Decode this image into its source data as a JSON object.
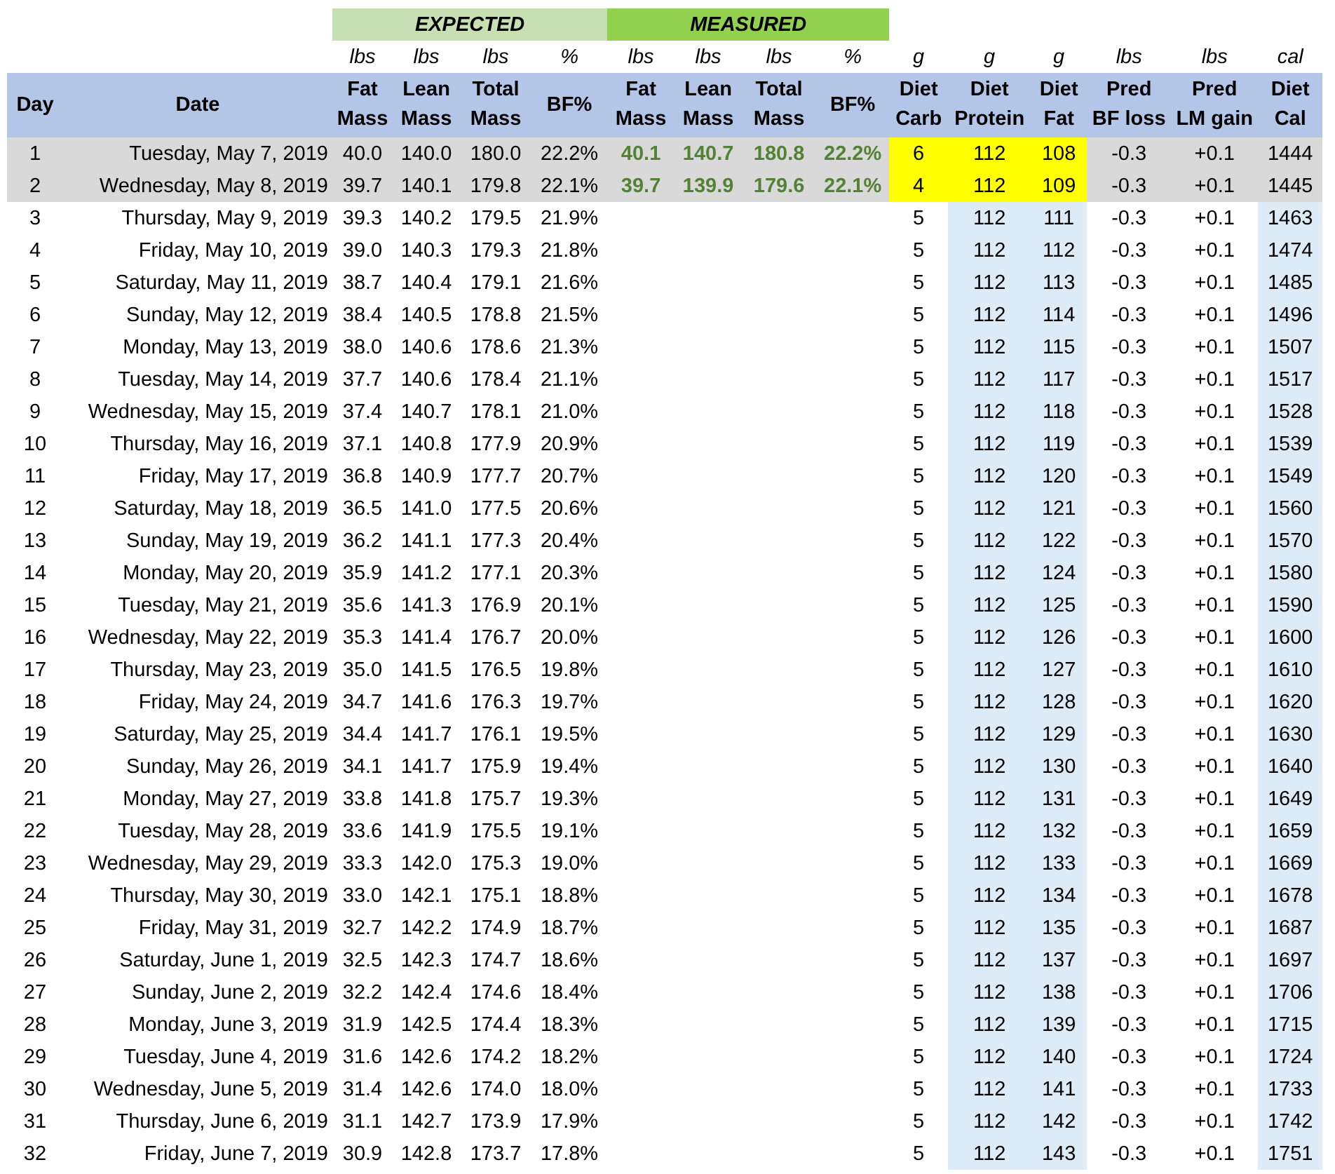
{
  "groups": [
    {
      "label": "EXPECTED",
      "color": "#c6e0b4"
    },
    {
      "label": "MEASURED",
      "color": "#92d050"
    }
  ],
  "units": [
    "lbs",
    "lbs",
    "lbs",
    "%",
    "lbs",
    "lbs",
    "lbs",
    "%",
    "g",
    "g",
    "g",
    "lbs",
    "lbs",
    "cal"
  ],
  "columns": [
    {
      "lines": [
        "Day"
      ]
    },
    {
      "lines": [
        "Date"
      ]
    },
    {
      "lines": [
        "Fat",
        "Mass"
      ]
    },
    {
      "lines": [
        "Lean",
        "Mass"
      ]
    },
    {
      "lines": [
        "Total",
        "Mass"
      ]
    },
    {
      "lines": [
        "BF%"
      ]
    },
    {
      "lines": [
        "Fat",
        "Mass"
      ]
    },
    {
      "lines": [
        "Lean",
        "Mass"
      ]
    },
    {
      "lines": [
        "Total",
        "Mass"
      ]
    },
    {
      "lines": [
        "BF%"
      ]
    },
    {
      "lines": [
        "Diet",
        "Carb"
      ]
    },
    {
      "lines": [
        "Diet",
        "Protein"
      ]
    },
    {
      "lines": [
        "Diet",
        "Fat"
      ]
    },
    {
      "lines": [
        "Pred",
        "BF loss"
      ]
    },
    {
      "lines": [
        "Pred",
        "LM gain"
      ]
    },
    {
      "lines": [
        "Diet",
        "Cal"
      ]
    }
  ],
  "rows": [
    {
      "day": "1",
      "date": "Tuesday, May 7, 2019",
      "expected": [
        "40.0",
        "140.0",
        "180.0",
        "22.2%"
      ],
      "measured": [
        "40.1",
        "140.7",
        "180.8",
        "22.2%"
      ],
      "diet": [
        "6",
        "112",
        "108"
      ],
      "pred": [
        "-0.3",
        "+0.1"
      ],
      "cal": "1444",
      "logged": true
    },
    {
      "day": "2",
      "date": "Wednesday, May 8, 2019",
      "expected": [
        "39.7",
        "140.1",
        "179.8",
        "22.1%"
      ],
      "measured": [
        "39.7",
        "139.9",
        "179.6",
        "22.1%"
      ],
      "diet": [
        "4",
        "112",
        "109"
      ],
      "pred": [
        "-0.3",
        "+0.1"
      ],
      "cal": "1445",
      "logged": true
    },
    {
      "day": "3",
      "date": "Thursday, May 9, 2019",
      "expected": [
        "39.3",
        "140.2",
        "179.5",
        "21.9%"
      ],
      "diet": [
        "5",
        "112",
        "111"
      ],
      "pred": [
        "-0.3",
        "+0.1"
      ],
      "cal": "1463",
      "logged": false
    },
    {
      "day": "4",
      "date": "Friday, May 10, 2019",
      "expected": [
        "39.0",
        "140.3",
        "179.3",
        "21.8%"
      ],
      "diet": [
        "5",
        "112",
        "112"
      ],
      "pred": [
        "-0.3",
        "+0.1"
      ],
      "cal": "1474",
      "logged": false
    },
    {
      "day": "5",
      "date": "Saturday, May 11, 2019",
      "expected": [
        "38.7",
        "140.4",
        "179.1",
        "21.6%"
      ],
      "diet": [
        "5",
        "112",
        "113"
      ],
      "pred": [
        "-0.3",
        "+0.1"
      ],
      "cal": "1485",
      "logged": false
    },
    {
      "day": "6",
      "date": "Sunday, May 12, 2019",
      "expected": [
        "38.4",
        "140.5",
        "178.8",
        "21.5%"
      ],
      "diet": [
        "5",
        "112",
        "114"
      ],
      "pred": [
        "-0.3",
        "+0.1"
      ],
      "cal": "1496",
      "logged": false
    },
    {
      "day": "7",
      "date": "Monday, May 13, 2019",
      "expected": [
        "38.0",
        "140.6",
        "178.6",
        "21.3%"
      ],
      "diet": [
        "5",
        "112",
        "115"
      ],
      "pred": [
        "-0.3",
        "+0.1"
      ],
      "cal": "1507",
      "logged": false
    },
    {
      "day": "8",
      "date": "Tuesday, May 14, 2019",
      "expected": [
        "37.7",
        "140.6",
        "178.4",
        "21.1%"
      ],
      "diet": [
        "5",
        "112",
        "117"
      ],
      "pred": [
        "-0.3",
        "+0.1"
      ],
      "cal": "1517",
      "logged": false
    },
    {
      "day": "9",
      "date": "Wednesday, May 15, 2019",
      "expected": [
        "37.4",
        "140.7",
        "178.1",
        "21.0%"
      ],
      "diet": [
        "5",
        "112",
        "118"
      ],
      "pred": [
        "-0.3",
        "+0.1"
      ],
      "cal": "1528",
      "logged": false
    },
    {
      "day": "10",
      "date": "Thursday, May 16, 2019",
      "expected": [
        "37.1",
        "140.8",
        "177.9",
        "20.9%"
      ],
      "diet": [
        "5",
        "112",
        "119"
      ],
      "pred": [
        "-0.3",
        "+0.1"
      ],
      "cal": "1539",
      "logged": false
    },
    {
      "day": "11",
      "date": "Friday, May 17, 2019",
      "expected": [
        "36.8",
        "140.9",
        "177.7",
        "20.7%"
      ],
      "diet": [
        "5",
        "112",
        "120"
      ],
      "pred": [
        "-0.3",
        "+0.1"
      ],
      "cal": "1549",
      "logged": false
    },
    {
      "day": "12",
      "date": "Saturday, May 18, 2019",
      "expected": [
        "36.5",
        "141.0",
        "177.5",
        "20.6%"
      ],
      "diet": [
        "5",
        "112",
        "121"
      ],
      "pred": [
        "-0.3",
        "+0.1"
      ],
      "cal": "1560",
      "logged": false
    },
    {
      "day": "13",
      "date": "Sunday, May 19, 2019",
      "expected": [
        "36.2",
        "141.1",
        "177.3",
        "20.4%"
      ],
      "diet": [
        "5",
        "112",
        "122"
      ],
      "pred": [
        "-0.3",
        "+0.1"
      ],
      "cal": "1570",
      "logged": false
    },
    {
      "day": "14",
      "date": "Monday, May 20, 2019",
      "expected": [
        "35.9",
        "141.2",
        "177.1",
        "20.3%"
      ],
      "diet": [
        "5",
        "112",
        "124"
      ],
      "pred": [
        "-0.3",
        "+0.1"
      ],
      "cal": "1580",
      "logged": false
    },
    {
      "day": "15",
      "date": "Tuesday, May 21, 2019",
      "expected": [
        "35.6",
        "141.3",
        "176.9",
        "20.1%"
      ],
      "diet": [
        "5",
        "112",
        "125"
      ],
      "pred": [
        "-0.3",
        "+0.1"
      ],
      "cal": "1590",
      "logged": false
    },
    {
      "day": "16",
      "date": "Wednesday, May 22, 2019",
      "expected": [
        "35.3",
        "141.4",
        "176.7",
        "20.0%"
      ],
      "diet": [
        "5",
        "112",
        "126"
      ],
      "pred": [
        "-0.3",
        "+0.1"
      ],
      "cal": "1600",
      "logged": false
    },
    {
      "day": "17",
      "date": "Thursday, May 23, 2019",
      "expected": [
        "35.0",
        "141.5",
        "176.5",
        "19.8%"
      ],
      "diet": [
        "5",
        "112",
        "127"
      ],
      "pred": [
        "-0.3",
        "+0.1"
      ],
      "cal": "1610",
      "logged": false
    },
    {
      "day": "18",
      "date": "Friday, May 24, 2019",
      "expected": [
        "34.7",
        "141.6",
        "176.3",
        "19.7%"
      ],
      "diet": [
        "5",
        "112",
        "128"
      ],
      "pred": [
        "-0.3",
        "+0.1"
      ],
      "cal": "1620",
      "logged": false
    },
    {
      "day": "19",
      "date": "Saturday, May 25, 2019",
      "expected": [
        "34.4",
        "141.7",
        "176.1",
        "19.5%"
      ],
      "diet": [
        "5",
        "112",
        "129"
      ],
      "pred": [
        "-0.3",
        "+0.1"
      ],
      "cal": "1630",
      "logged": false
    },
    {
      "day": "20",
      "date": "Sunday, May 26, 2019",
      "expected": [
        "34.1",
        "141.7",
        "175.9",
        "19.4%"
      ],
      "diet": [
        "5",
        "112",
        "130"
      ],
      "pred": [
        "-0.3",
        "+0.1"
      ],
      "cal": "1640",
      "logged": false
    },
    {
      "day": "21",
      "date": "Monday, May 27, 2019",
      "expected": [
        "33.8",
        "141.8",
        "175.7",
        "19.3%"
      ],
      "diet": [
        "5",
        "112",
        "131"
      ],
      "pred": [
        "-0.3",
        "+0.1"
      ],
      "cal": "1649",
      "logged": false
    },
    {
      "day": "22",
      "date": "Tuesday, May 28, 2019",
      "expected": [
        "33.6",
        "141.9",
        "175.5",
        "19.1%"
      ],
      "diet": [
        "5",
        "112",
        "132"
      ],
      "pred": [
        "-0.3",
        "+0.1"
      ],
      "cal": "1659",
      "logged": false
    },
    {
      "day": "23",
      "date": "Wednesday, May 29, 2019",
      "expected": [
        "33.3",
        "142.0",
        "175.3",
        "19.0%"
      ],
      "diet": [
        "5",
        "112",
        "133"
      ],
      "pred": [
        "-0.3",
        "+0.1"
      ],
      "cal": "1669",
      "logged": false
    },
    {
      "day": "24",
      "date": "Thursday, May 30, 2019",
      "expected": [
        "33.0",
        "142.1",
        "175.1",
        "18.8%"
      ],
      "diet": [
        "5",
        "112",
        "134"
      ],
      "pred": [
        "-0.3",
        "+0.1"
      ],
      "cal": "1678",
      "logged": false
    },
    {
      "day": "25",
      "date": "Friday, May 31, 2019",
      "expected": [
        "32.7",
        "142.2",
        "174.9",
        "18.7%"
      ],
      "diet": [
        "5",
        "112",
        "135"
      ],
      "pred": [
        "-0.3",
        "+0.1"
      ],
      "cal": "1687",
      "logged": false
    },
    {
      "day": "26",
      "date": "Saturday, June 1, 2019",
      "expected": [
        "32.5",
        "142.3",
        "174.7",
        "18.6%"
      ],
      "diet": [
        "5",
        "112",
        "137"
      ],
      "pred": [
        "-0.3",
        "+0.1"
      ],
      "cal": "1697",
      "logged": false
    },
    {
      "day": "27",
      "date": "Sunday, June 2, 2019",
      "expected": [
        "32.2",
        "142.4",
        "174.6",
        "18.4%"
      ],
      "diet": [
        "5",
        "112",
        "138"
      ],
      "pred": [
        "-0.3",
        "+0.1"
      ],
      "cal": "1706",
      "logged": false
    },
    {
      "day": "28",
      "date": "Monday, June 3, 2019",
      "expected": [
        "31.9",
        "142.5",
        "174.4",
        "18.3%"
      ],
      "diet": [
        "5",
        "112",
        "139"
      ],
      "pred": [
        "-0.3",
        "+0.1"
      ],
      "cal": "1715",
      "logged": false
    },
    {
      "day": "29",
      "date": "Tuesday, June 4, 2019",
      "expected": [
        "31.6",
        "142.6",
        "174.2",
        "18.2%"
      ],
      "diet": [
        "5",
        "112",
        "140"
      ],
      "pred": [
        "-0.3",
        "+0.1"
      ],
      "cal": "1724",
      "logged": false
    },
    {
      "day": "30",
      "date": "Wednesday, June 5, 2019",
      "expected": [
        "31.4",
        "142.6",
        "174.0",
        "18.0%"
      ],
      "diet": [
        "5",
        "112",
        "141"
      ],
      "pred": [
        "-0.3",
        "+0.1"
      ],
      "cal": "1733",
      "logged": false
    },
    {
      "day": "31",
      "date": "Thursday, June 6, 2019",
      "expected": [
        "31.1",
        "142.7",
        "173.9",
        "17.9%"
      ],
      "diet": [
        "5",
        "112",
        "142"
      ],
      "pred": [
        "-0.3",
        "+0.1"
      ],
      "cal": "1742",
      "logged": false
    },
    {
      "day": "32",
      "date": "Friday, June 7, 2019",
      "expected": [
        "30.9",
        "142.8",
        "173.7",
        "17.8%"
      ],
      "diet": [
        "5",
        "112",
        "143"
      ],
      "pred": [
        "-0.3",
        "+0.1"
      ],
      "cal": "1751",
      "logged": false
    }
  ]
}
